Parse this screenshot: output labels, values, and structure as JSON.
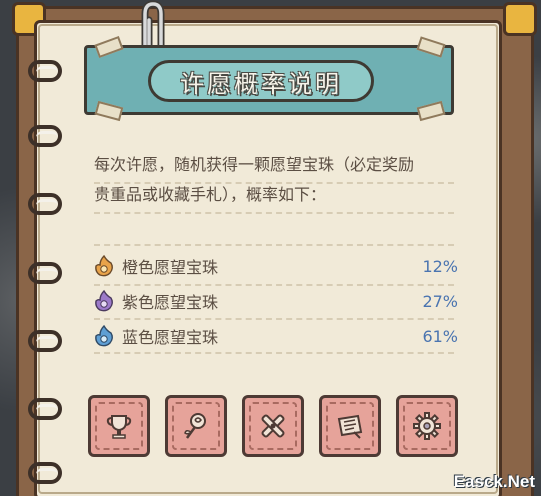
{
  "panel": {
    "title": "许愿概率说明",
    "description_line1": "每次许愿，随机获得一颗愿望宝珠（必定奖励",
    "description_line2": "贵重品或收藏手札），概率如下："
  },
  "rates": [
    {
      "name": "橙色愿望宝珠",
      "percent": "12%",
      "color": "#e8a34a",
      "icon": "orange-orb-icon"
    },
    {
      "name": "紫色愿望宝珠",
      "percent": "27%",
      "color": "#9c7ac9",
      "icon": "purple-orb-icon"
    },
    {
      "name": "蓝色愿望宝珠",
      "percent": "61%",
      "color": "#5f9fd4",
      "icon": "blue-orb-icon"
    }
  ],
  "stamps": [
    {
      "icon": "trophy-cup-icon"
    },
    {
      "icon": "rose-icon"
    },
    {
      "icon": "crossed-tools-icon"
    },
    {
      "icon": "scroll-map-icon"
    },
    {
      "icon": "gear-icon"
    }
  ],
  "watermark": "Easck.Net"
}
